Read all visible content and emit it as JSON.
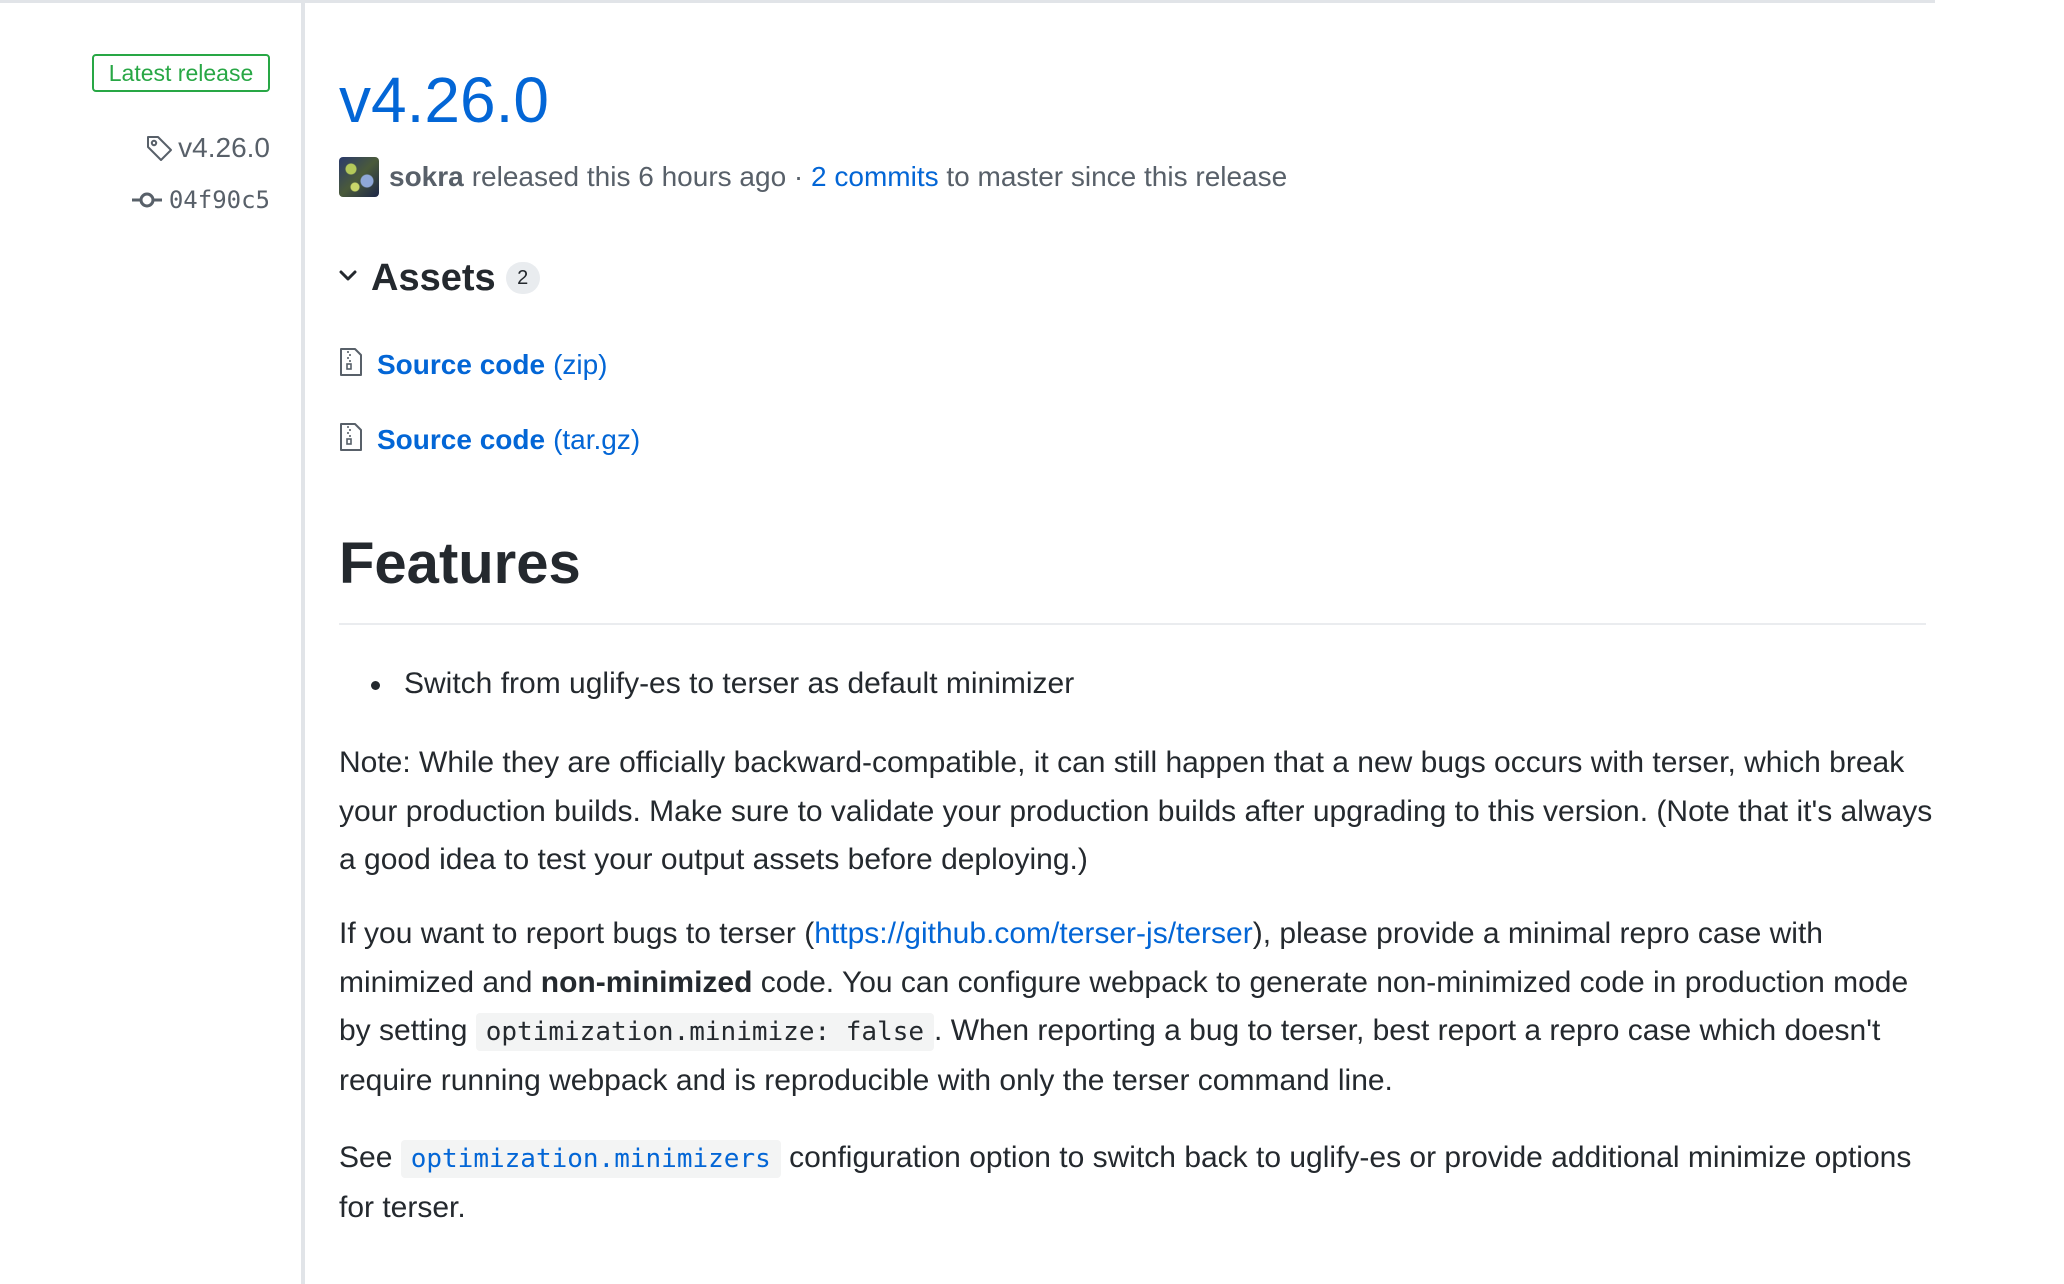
{
  "sidebar": {
    "badge": "Latest release",
    "tag": "v4.26.0",
    "commit": "04f90c5",
    "icons": {
      "tag": "tag-icon",
      "commit": "git-commit-icon"
    }
  },
  "release": {
    "title": "v4.26.0",
    "author": "sokra",
    "released_text": "released this 6 hours ago ·",
    "commits_link": "2 commits",
    "commits_suffix": "to master since this release"
  },
  "assets": {
    "title": "Assets",
    "count": "2",
    "items": [
      {
        "name": "Source code",
        "type": "(zip)",
        "icon": "file-zip-icon"
      },
      {
        "name": "Source code",
        "type": "(tar.gz)",
        "icon": "file-zip-icon"
      }
    ]
  },
  "body": {
    "heading": "Features",
    "bullets": [
      "Switch from uglify-es to terser as default minimizer"
    ],
    "note": "Note: While they are officially backward-compatible, it can still happen that a new bugs occurs with terser, which break your production builds. Make sure to validate your production builds after upgrading to this version. (Note that it's always a good idea to test your output assets before deploying.)",
    "report": {
      "t1": "If you want to report bugs to terser (",
      "link": "https://github.com/terser-js/terser",
      "t2": "), please provide a minimal repro case with minimized and ",
      "bold": "non-minimized",
      "t3": " code. You can configure webpack to generate non-minimized code in production mode by setting ",
      "code": "optimization.minimize: false",
      "t4": ". When reporting a bug to terser, best report a repro case which doesn't require running webpack and is reproducible with only the terser command line."
    },
    "see": {
      "t1": "See ",
      "code": "optimization.minimizers",
      "t2": " configuration option to switch back to uglify-es or provide additional minimize options for terser."
    }
  },
  "colors": {
    "link": "#0366d6",
    "badge_green": "#28a745",
    "text": "#24292e",
    "muted": "#586069"
  }
}
